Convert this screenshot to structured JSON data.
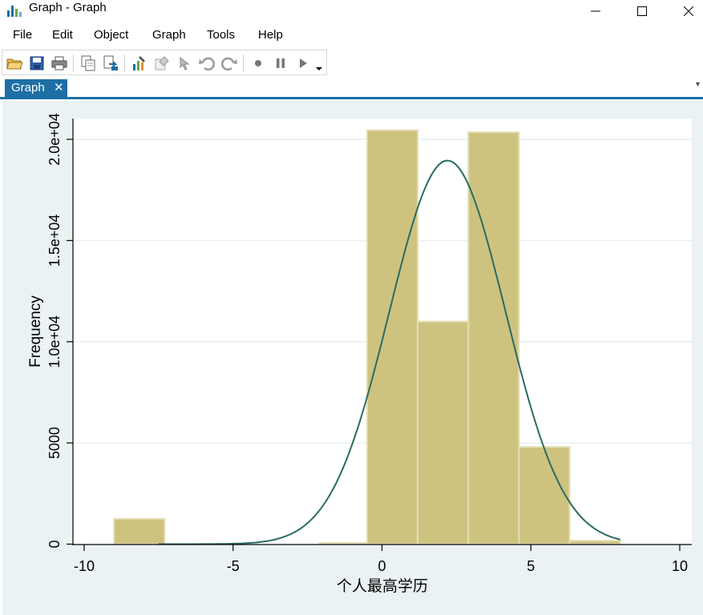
{
  "window": {
    "title": "Graph - Graph",
    "controls": {
      "minimize": "—",
      "maximize": "☐",
      "close": "✕"
    }
  },
  "menu": [
    "File",
    "Edit",
    "Object",
    "Graph",
    "Tools",
    "Help"
  ],
  "toolbar": {
    "icons": [
      "open-icon",
      "save-icon",
      "print-icon",
      "copy-icon",
      "copy-to-doc-icon",
      "graph-editor-icon",
      "rename-icon",
      "pointer-icon",
      "undo-icon",
      "redo-icon",
      "record-icon",
      "pause-icon",
      "play-icon",
      "dropdown-icon"
    ]
  },
  "tabs": [
    {
      "label": "Graph",
      "close": "✕",
      "active": true
    }
  ],
  "colors": {
    "tab_bg": "#1d6fa5",
    "graph_bg": "#eaf2f3",
    "bar_fill": "#cdc37f",
    "bar_edge": "#e4dfb4",
    "curve": "#2b6b62",
    "grid": "#e9f0f1"
  },
  "chart_data": {
    "type": "bar",
    "title": "",
    "xlabel": "个人最高学历",
    "ylabel": "Frequency",
    "xlim": [
      -10,
      10
    ],
    "ylim": [
      0,
      21000
    ],
    "x_ticks": [
      -10,
      -5,
      0,
      5,
      10
    ],
    "x_tick_labels": [
      "-10",
      "-5",
      "0",
      "5",
      "10"
    ],
    "y_ticks": [
      0,
      5000,
      10000,
      15000,
      20000
    ],
    "y_tick_labels": [
      "0",
      "5000",
      "1.0e+04",
      "1.5e+04",
      "2.0e+04"
    ],
    "grid": true,
    "bins": [
      {
        "x0": -9.0,
        "x1": -7.3,
        "value": 1250
      },
      {
        "x0": -2.1,
        "x1": -0.5,
        "value": 60
      },
      {
        "x0": -0.5,
        "x1": 1.2,
        "value": 20450
      },
      {
        "x0": 1.2,
        "x1": 2.9,
        "value": 11000
      },
      {
        "x0": 2.9,
        "x1": 4.6,
        "value": 20350
      },
      {
        "x0": 4.6,
        "x1": 6.3,
        "value": 4800
      },
      {
        "x0": 6.3,
        "x1": 8.0,
        "value": 170
      }
    ],
    "normal_curve": {
      "mean": 2.2,
      "sd": 1.95,
      "peak": 18950,
      "x_range": [
        -7.5,
        8.0
      ]
    }
  }
}
